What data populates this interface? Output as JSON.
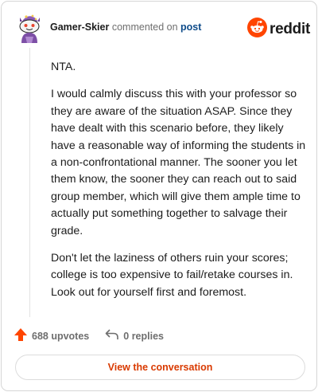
{
  "header": {
    "username": "Gamer-Skier",
    "action_text": "commented on",
    "target": "post"
  },
  "brand": {
    "wordmark": "reddit",
    "icon": "reddit-logo-icon",
    "color": "#ff4500"
  },
  "avatar": {
    "icon": "snoo-avatar-icon"
  },
  "comment": {
    "paragraphs": [
      "NTA.",
      "I would calmly discuss this with your professor so they are aware of the situation ASAP. Since they have dealt with this scenario before, they likely have a reasonable way of informing the students in a non-confrontational manner. The sooner you let them know, the sooner they can reach out to said group member, which will give them ample time to actually put something together to salvage their grade.",
      "Don't let the laziness of others ruin your scores; college is too expensive to fail/retake courses in. Look out for yourself first and foremost."
    ]
  },
  "actions": {
    "upvotes": "688 upvotes",
    "upvote_icon": "upvote-arrow-icon",
    "upvote_color": "#ff4500",
    "replies": "0 replies",
    "reply_icon": "reply-arrow-icon"
  },
  "cta": {
    "label": "View the conversation",
    "color": "#d93a00"
  }
}
